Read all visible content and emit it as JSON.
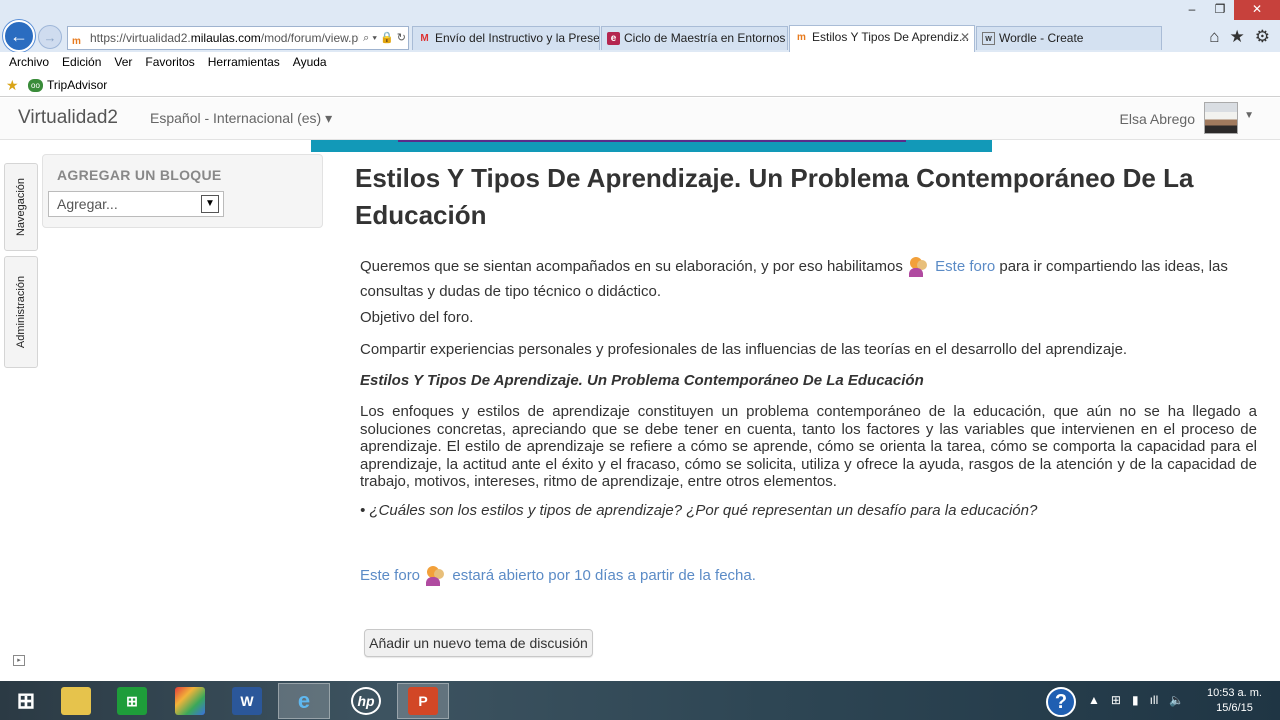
{
  "browser": {
    "address": {
      "url_prefix": "https://virtualidad2.",
      "url_host": "milaulas.com",
      "url_suffix": "/mod/forum/view.php",
      "icons": "⌕ ▾ 🔒 ↻"
    },
    "tabs": [
      {
        "label": "Envío del Instructivo y la Prese...",
        "icon": "gmail-icon"
      },
      {
        "label": "Ciclo de Maestría en Entornos ...",
        "icon": "page-icon"
      },
      {
        "label": "Estilos Y Tipos De Aprendiz...",
        "icon": "moodle-icon",
        "active": true
      },
      {
        "label": "Wordle - Create",
        "icon": "wordle-icon"
      }
    ],
    "menu": [
      "Archivo",
      "Edición",
      "Ver",
      "Favoritos",
      "Herramientas",
      "Ayuda"
    ],
    "favorites": [
      {
        "label": "TripAdvisor"
      }
    ]
  },
  "header": {
    "site_name": "Virtualidad2",
    "language": "Español - Internacional (es) ▾",
    "user_name": "Elsa Abrego"
  },
  "dock": {
    "navigation": "Navegación",
    "administration": "Administración"
  },
  "block": {
    "title": "AGREGAR UN BLOQUE",
    "select_value": "Agregar..."
  },
  "main": {
    "title": "Estilos Y Tipos De Aprendizaje. Un Problema Contemporáneo De La Educación",
    "intro_before": "Queremos que se sientan acompañados en su elaboración, y por eso habilitamos ",
    "intro_link": "Este foro",
    "intro_after": "  para ir compartiendo las  ideas, las consultas y dudas de tipo técnico o didáctico.",
    "objective_label": "Objetivo del foro.",
    "objective_text": "Compartir experiencias personales y profesionales de las  influencias de las teorías en el desarrollo del aprendizaje.",
    "subtitle": "Estilos Y Tipos De Aprendizaje. Un Problema Contemporáneo De La Educación",
    "body": "Los enfoques y estilos de aprendizaje constituyen un problema contemporáneo de la educación, que aún no se ha llegado a soluciones concretas, apreciando que se debe tener en cuenta, tanto los factores y las variables que intervienen en el proceso de aprendizaje. El estilo de aprendizaje se refiere a cómo se aprende, cómo se orienta la tarea, cómo se comporta la capacidad para el aprendizaje, la actitud ante el éxito y el fracaso, cómo se solicita, utiliza y ofrece la ayuda, rasgos de la atención y de la capacidad de trabajo, motivos, intereses, ritmo de aprendizaje, entre otros elementos.",
    "question": "• ¿Cuáles son  los estilos y tipos de aprendizaje? ¿Por qué representan un desafío para la educación?",
    "footer_link": "Este foro",
    "footer_after": "estará abierto por 10 días a partir de la fecha.",
    "add_topic_button": "Añadir un nuevo tema de discusión"
  },
  "taskbar": {
    "apps": [
      "start-icon",
      "file-explorer-icon",
      "store-icon",
      "photos-icon",
      "word-icon",
      "internet-explorer-icon",
      "hp-icon",
      "powerpoint-icon"
    ],
    "time": "10:53 a. m.",
    "date": "15/6/15"
  }
}
